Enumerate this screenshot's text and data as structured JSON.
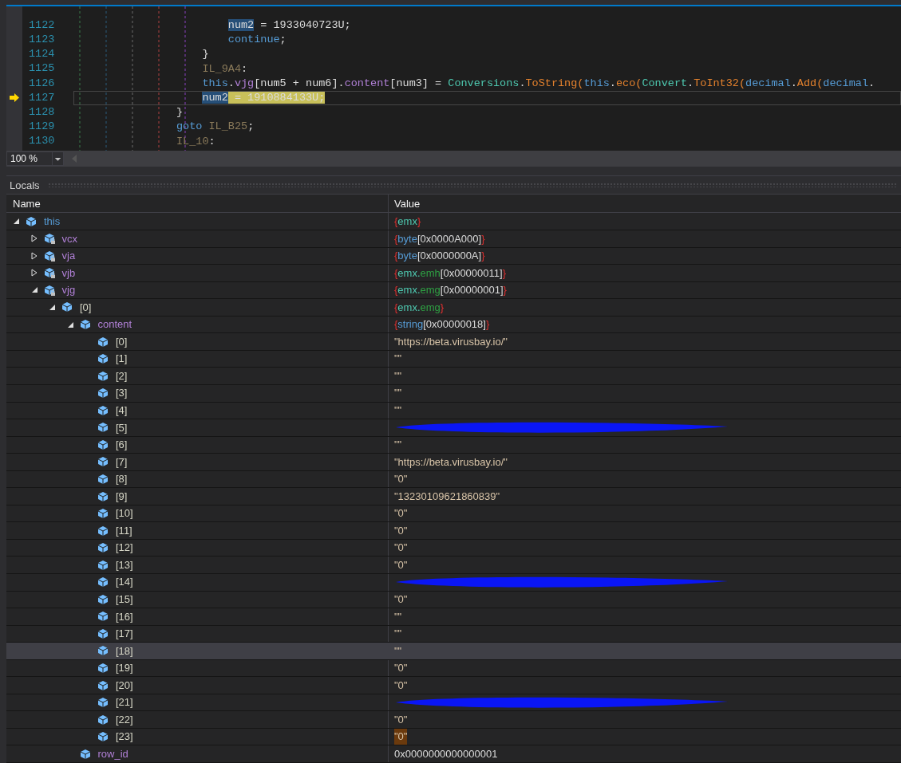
{
  "editor": {
    "lines": [
      {
        "children": [
          {
            "children": [
              {
                "number": "1122",
                "current": false,
                "tokens": [
                  {
                    "kind": "ref",
                    "text": "num2"
                  },
                  {
                    "kind": "plain",
                    "text": " = 1933040723U;"
                  }
                ]
              },
              {
                "number": "1123",
                "current": false,
                "tokens": [
                  {
                    "kind": "keyword",
                    "text": "continue"
                  },
                  {
                    "kind": "plain",
                    "text": ";"
                  }
                ]
              }
            ]
          },
          {
            "number": "1124",
            "current": false,
            "tokens": [
              {
                "kind": "plain",
                "text": "}"
              }
            ]
          },
          {
            "number": "1125",
            "current": false,
            "tokens": [
              {
                "kind": "label",
                "text": "IL_9A4"
              },
              {
                "kind": "plain",
                "text": ":"
              }
            ]
          },
          {
            "number": "1126",
            "current": false,
            "tokens": [
              {
                "kind": "keyword",
                "text": "this"
              },
              {
                "kind": "plain",
                "text": "."
              },
              {
                "kind": "field",
                "text": "vjg"
              },
              {
                "kind": "plain",
                "text": "[num5 + num6]."
              },
              {
                "kind": "field",
                "text": "content"
              },
              {
                "kind": "plain",
                "text": "[num3] = "
              },
              {
                "kind": "type",
                "text": "Conversions"
              },
              {
                "kind": "plain",
                "text": "."
              },
              {
                "kind": "method",
                "text": "ToString"
              },
              {
                "kind": "method",
                "text": "("
              },
              {
                "kind": "keyword",
                "text": "this"
              },
              {
                "kind": "plain",
                "text": "."
              },
              {
                "kind": "method",
                "text": "eco"
              },
              {
                "kind": "method",
                "text": "("
              },
              {
                "kind": "type",
                "text": "Convert"
              },
              {
                "kind": "plain",
                "text": "."
              },
              {
                "kind": "method",
                "text": "ToInt32"
              },
              {
                "kind": "method",
                "text": "("
              },
              {
                "kind": "keyword",
                "text": "decimal"
              },
              {
                "kind": "plain",
                "text": "."
              },
              {
                "kind": "method",
                "text": "Add"
              },
              {
                "kind": "method",
                "text": "("
              },
              {
                "kind": "keyword",
                "text": "decimal"
              },
              {
                "kind": "plain",
                "text": "."
              }
            ]
          },
          {
            "number": "1127",
            "current": true,
            "tokens": [
              {
                "kind": "ref",
                "text": "num2"
              },
              {
                "kind": "plain",
                "text": " = 1910884133U;"
              }
            ]
          }
        ]
      },
      {
        "number": "1128",
        "current": false,
        "tokens": [
          {
            "kind": "plain",
            "text": "}"
          }
        ]
      },
      {
        "number": "1129",
        "current": false,
        "tokens": [
          {
            "kind": "keyword",
            "text": "goto"
          },
          {
            "kind": "label",
            "text": " IL_B25"
          },
          {
            "kind": "plain",
            "text": ";"
          }
        ]
      },
      {
        "number": "1130",
        "current": false,
        "tokens": [
          {
            "kind": "label",
            "text": "IL_10"
          },
          {
            "kind": "plain",
            "text": ":"
          }
        ]
      }
    ],
    "zoom": "100 %"
  },
  "locals": {
    "title": "Locals",
    "columns": [
      "Name",
      "Value"
    ],
    "rows": [
      {
        "name": "this",
        "selected": false,
        "expanded": true,
        "value": [
          {
            "kind": "brace",
            "text": "{"
          },
          {
            "kind": "type",
            "text": "emx"
          },
          {
            "kind": "brace",
            "text": "}"
          }
        ],
        "children": [
          {
            "name": "vcx",
            "private": true,
            "selected": false,
            "expanded": false,
            "value": [
              {
                "kind": "brace",
                "text": "{"
              },
              {
                "kind": "keyword",
                "text": "byte"
              },
              {
                "kind": "plain",
                "text": "[0x0000A000]"
              },
              {
                "kind": "brace",
                "text": "}"
              }
            ]
          },
          {
            "name": "vja",
            "private": true,
            "selected": false,
            "expanded": false,
            "value": [
              {
                "kind": "brace",
                "text": "{"
              },
              {
                "kind": "keyword",
                "text": "byte"
              },
              {
                "kind": "plain",
                "text": "[0x0000000A]"
              },
              {
                "kind": "brace",
                "text": "}"
              }
            ]
          },
          {
            "name": "vjb",
            "private": true,
            "selected": false,
            "expanded": false,
            "value": [
              {
                "kind": "brace",
                "text": "{"
              },
              {
                "kind": "type",
                "text": "emx."
              },
              {
                "kind": "class",
                "text": "emh"
              },
              {
                "kind": "plain",
                "text": "[0x00000011]"
              },
              {
                "kind": "brace",
                "text": "}"
              }
            ]
          },
          {
            "name": "vjg",
            "private": true,
            "selected": false,
            "expanded": true,
            "value": [
              {
                "kind": "brace",
                "text": "{"
              },
              {
                "kind": "type",
                "text": "emx."
              },
              {
                "kind": "class",
                "text": "emg"
              },
              {
                "kind": "plain",
                "text": "[0x00000001]"
              },
              {
                "kind": "brace",
                "text": "}"
              }
            ],
            "children": [
              {
                "name": "[0]",
                "selected": false,
                "expanded": true,
                "value": [
                  {
                    "kind": "brace",
                    "text": "{"
                  },
                  {
                    "kind": "type",
                    "text": "emx."
                  },
                  {
                    "kind": "class",
                    "text": "emg"
                  },
                  {
                    "kind": "brace",
                    "text": "}"
                  }
                ],
                "children": [
                  {
                    "name": "content",
                    "selected": false,
                    "expanded": true,
                    "value": [
                      {
                        "kind": "brace",
                        "text": "{"
                      },
                      {
                        "kind": "keyword",
                        "text": "string"
                      },
                      {
                        "kind": "plain",
                        "text": "[0x00000018]"
                      },
                      {
                        "kind": "brace",
                        "text": "}"
                      }
                    ],
                    "children": [
                      {
                        "name": "[0]",
                        "selected": false,
                        "changed": false,
                        "redacted": false,
                        "value": [
                          {
                            "kind": "string",
                            "text": "\"https://beta.virusbay.io/\""
                          }
                        ]
                      },
                      {
                        "name": "[1]",
                        "selected": false,
                        "changed": false,
                        "redacted": false,
                        "value": [
                          {
                            "kind": "string",
                            "text": "\"\""
                          }
                        ]
                      },
                      {
                        "name": "[2]",
                        "selected": false,
                        "changed": false,
                        "redacted": false,
                        "value": [
                          {
                            "kind": "string",
                            "text": "\"\""
                          }
                        ]
                      },
                      {
                        "name": "[3]",
                        "selected": false,
                        "changed": false,
                        "redacted": false,
                        "value": [
                          {
                            "kind": "string",
                            "text": "\"\""
                          }
                        ]
                      },
                      {
                        "name": "[4]",
                        "selected": false,
                        "changed": false,
                        "redacted": false,
                        "value": [
                          {
                            "kind": "string",
                            "text": "\"\""
                          }
                        ]
                      },
                      {
                        "name": "[5]",
                        "selected": false,
                        "changed": false,
                        "redacted": true
                      },
                      {
                        "name": "[6]",
                        "selected": false,
                        "changed": false,
                        "redacted": false,
                        "value": [
                          {
                            "kind": "string",
                            "text": "\"\""
                          }
                        ]
                      },
                      {
                        "name": "[7]",
                        "selected": false,
                        "changed": false,
                        "redacted": false,
                        "value": [
                          {
                            "kind": "string",
                            "text": "\"https://beta.virusbay.io/\""
                          }
                        ]
                      },
                      {
                        "name": "[8]",
                        "selected": false,
                        "changed": false,
                        "redacted": false,
                        "value": [
                          {
                            "kind": "string",
                            "text": "\"0\""
                          }
                        ]
                      },
                      {
                        "name": "[9]",
                        "selected": false,
                        "changed": false,
                        "redacted": false,
                        "value": [
                          {
                            "kind": "string",
                            "text": "\"13230109621860839\""
                          }
                        ]
                      },
                      {
                        "name": "[10]",
                        "selected": false,
                        "changed": false,
                        "redacted": false,
                        "value": [
                          {
                            "kind": "string",
                            "text": "\"0\""
                          }
                        ]
                      },
                      {
                        "name": "[11]",
                        "selected": false,
                        "changed": false,
                        "redacted": false,
                        "value": [
                          {
                            "kind": "string",
                            "text": "\"0\""
                          }
                        ]
                      },
                      {
                        "name": "[12]",
                        "selected": false,
                        "changed": false,
                        "redacted": false,
                        "value": [
                          {
                            "kind": "string",
                            "text": "\"0\""
                          }
                        ]
                      },
                      {
                        "name": "[13]",
                        "selected": false,
                        "changed": false,
                        "redacted": false,
                        "value": [
                          {
                            "kind": "string",
                            "text": "\"0\""
                          }
                        ]
                      },
                      {
                        "name": "[14]",
                        "selected": false,
                        "changed": false,
                        "redacted": true
                      },
                      {
                        "name": "[15]",
                        "selected": false,
                        "changed": false,
                        "redacted": false,
                        "value": [
                          {
                            "kind": "string",
                            "text": "\"0\""
                          }
                        ]
                      },
                      {
                        "name": "[16]",
                        "selected": false,
                        "changed": false,
                        "redacted": false,
                        "value": [
                          {
                            "kind": "string",
                            "text": "\"\""
                          }
                        ]
                      },
                      {
                        "name": "[17]",
                        "selected": false,
                        "changed": false,
                        "redacted": false,
                        "value": [
                          {
                            "kind": "string",
                            "text": "\"\""
                          }
                        ]
                      },
                      {
                        "name": "[18]",
                        "selected": true,
                        "changed": false,
                        "redacted": false,
                        "value": [
                          {
                            "kind": "string",
                            "text": "\"\""
                          }
                        ]
                      },
                      {
                        "name": "[19]",
                        "selected": false,
                        "changed": false,
                        "redacted": false,
                        "value": [
                          {
                            "kind": "string",
                            "text": "\"0\""
                          }
                        ]
                      },
                      {
                        "name": "[20]",
                        "selected": false,
                        "changed": false,
                        "redacted": false,
                        "value": [
                          {
                            "kind": "string",
                            "text": "\"0\""
                          }
                        ]
                      },
                      {
                        "name": "[21]",
                        "selected": false,
                        "changed": false,
                        "redacted": true
                      },
                      {
                        "name": "[22]",
                        "selected": false,
                        "changed": false,
                        "redacted": false,
                        "value": [
                          {
                            "kind": "string",
                            "text": "\"0\""
                          }
                        ]
                      },
                      {
                        "name": "[23]",
                        "selected": false,
                        "changed": true,
                        "redacted": false,
                        "value": [
                          {
                            "kind": "string",
                            "text": "\"0\""
                          }
                        ]
                      }
                    ]
                  },
                  {
                    "name": "row_id",
                    "selected": false,
                    "value": [
                      {
                        "kind": "plain",
                        "text": "0x0000000000000001"
                      }
                    ]
                  }
                ]
              }
            ]
          }
        ]
      }
    ]
  }
}
